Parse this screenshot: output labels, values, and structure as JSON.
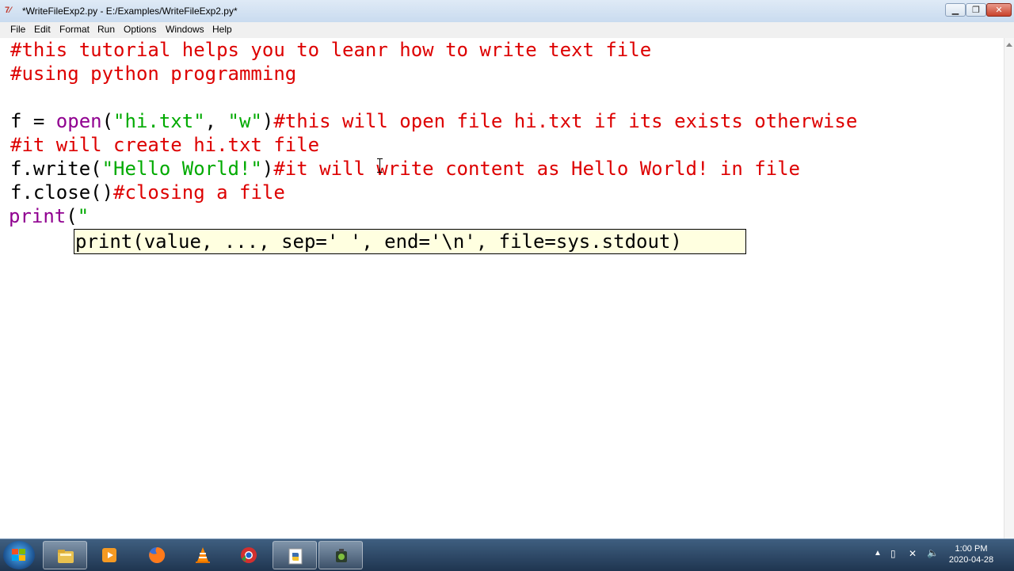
{
  "window": {
    "title": "*WriteFileExp2.py - E:/Examples/WriteFileExp2.py*",
    "app_icon": "idle-python-icon"
  },
  "menubar": {
    "items": [
      "File",
      "Edit",
      "Format",
      "Run",
      "Options",
      "Windows",
      "Help"
    ]
  },
  "editor": {
    "lines": [
      {
        "comment": "#this tutorial helps you to leanr how to write text file"
      },
      {
        "comment": "#using python programming"
      },
      {},
      {
        "code1": "f = ",
        "builtin": "open",
        "code2": "(",
        "str1": "\"hi.txt\"",
        "code3": ", ",
        "str2": "\"w\"",
        "code4": ")",
        "comment": "#this will open file hi.txt if its exists otherwise"
      },
      {
        "comment": "#it will create hi.txt file"
      },
      {
        "code1": "f.write(",
        "str1": "\"Hello World!\"",
        "code2": ")",
        "comment": "#it will write content as Hello World! in file"
      },
      {
        "code1": "f.close()",
        "comment": "#closing a file"
      },
      {
        "builtin": "print",
        "code1": "(",
        "str1": "\""
      }
    ],
    "calltip": "print(value, ..., sep=' ', end='\\n', file=sys.stdout)"
  },
  "taskbar": {
    "apps": [
      "start-button",
      "file-explorer",
      "media-player",
      "firefox",
      "vlc",
      "chrome",
      "python-idle",
      "camtasia-recorder"
    ],
    "clock_time": "1:00 PM",
    "clock_date": "2020-04-28"
  },
  "colors": {
    "comment": "#dd0000",
    "string": "#00aa00",
    "builtin": "#900090",
    "calltip_bg": "#ffffe0"
  }
}
